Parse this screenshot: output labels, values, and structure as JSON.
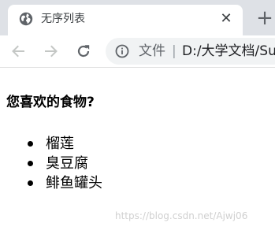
{
  "browser": {
    "tab": {
      "title": "无序列表",
      "close_glyph": "✕",
      "favicon": "globe-icon"
    },
    "new_tab_glyph": "+",
    "toolbar": {
      "back_icon": "arrow-left-icon",
      "forward_icon": "arrow-right-icon",
      "reload_icon": "reload-icon"
    },
    "omnibox": {
      "info_icon": "info-icon",
      "label": "文件",
      "separator": "|",
      "url": "D:/大学文档/Su"
    }
  },
  "page": {
    "heading": "您喜欢的食物?",
    "list": [
      {
        "label": "榴莲"
      },
      {
        "label": "臭豆腐"
      },
      {
        "label": "鲱鱼罐头"
      }
    ]
  },
  "watermark": "https://blog.csdn.net/Ajwj06"
}
